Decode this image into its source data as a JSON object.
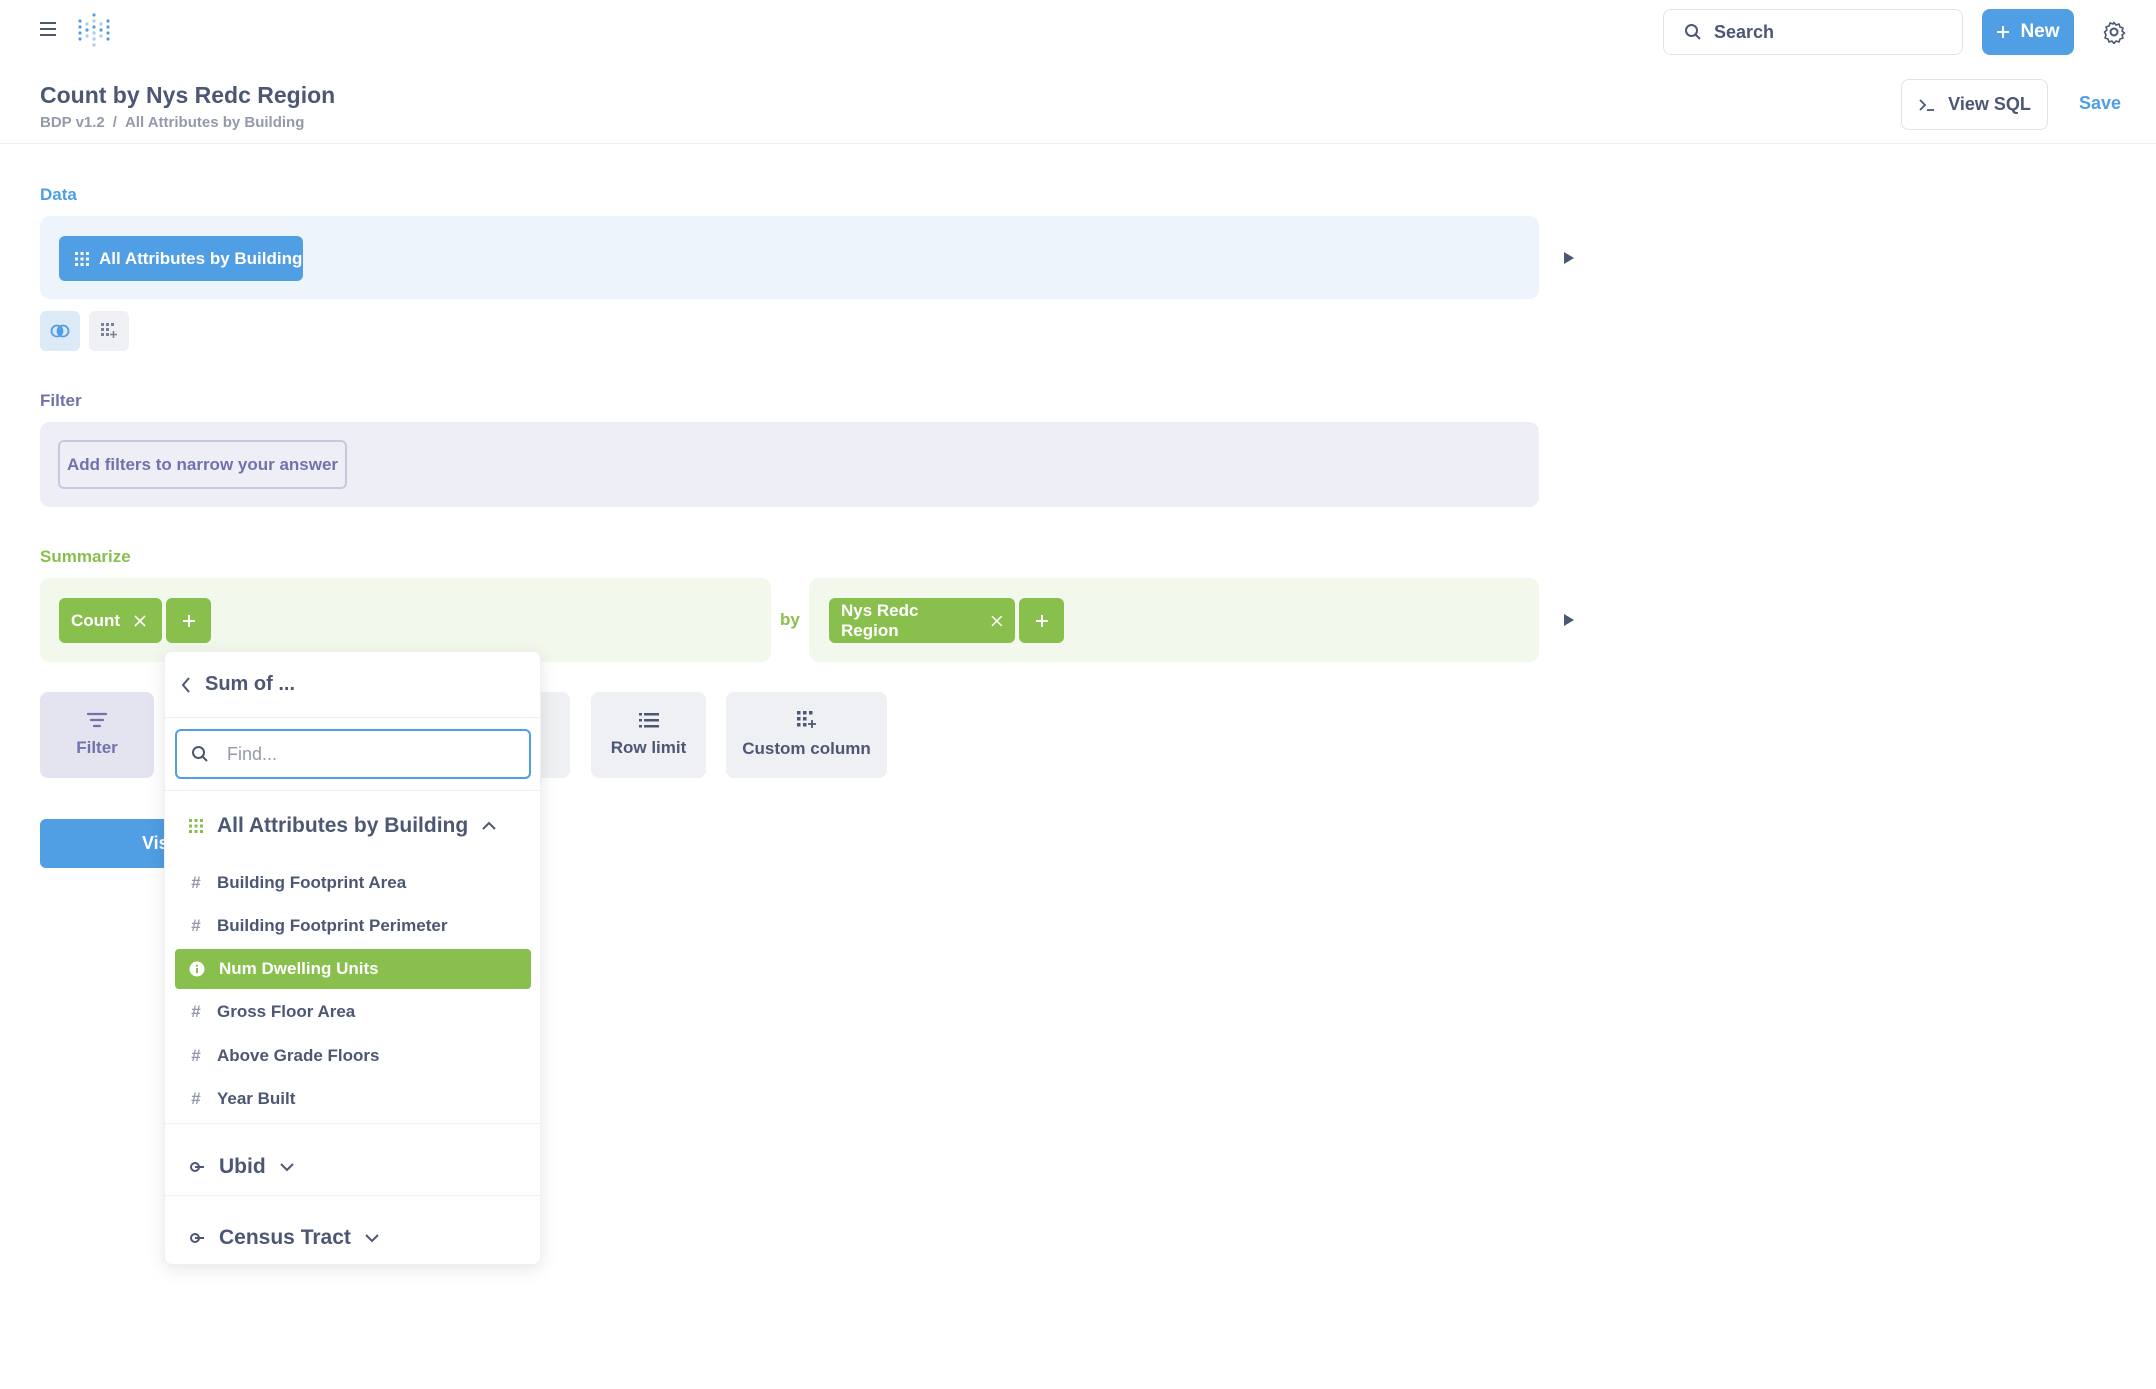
{
  "nav": {
    "search_label": "Search",
    "new_label": "New"
  },
  "header": {
    "title": "Count by Nys Redc Region",
    "breadcrumb": [
      "BDP v1.2",
      "/",
      "All Attributes by Building"
    ],
    "view_sql_label": "View SQL",
    "save_label": "Save"
  },
  "data_section": {
    "label": "Data",
    "table_name": "All Attributes by Building"
  },
  "filter_section": {
    "label": "Filter",
    "button_label": "Add filters to narrow your answer"
  },
  "summarize_section": {
    "label": "Summarize",
    "metric": "Count",
    "by_label": "by",
    "breakout": "Nys Redc Region"
  },
  "actions": {
    "filter": "Filter",
    "row_limit": "Row limit",
    "custom_column": "Custom column",
    "visualize_partial": "Vis"
  },
  "popover": {
    "header": "Sum of ...",
    "search_placeholder": "Find...",
    "groups": {
      "main": "All Attributes by Building",
      "ubid": "Ubid",
      "census": "Census Tract"
    },
    "items": [
      {
        "label": "Building Footprint Area"
      },
      {
        "label": "Building Footprint Perimeter"
      },
      {
        "label": "Num Dwelling Units"
      },
      {
        "label": "Gross Floor Area"
      },
      {
        "label": "Above Grade Floors"
      },
      {
        "label": "Year Built"
      }
    ],
    "selected_index": 2
  },
  "colors": {
    "brand": "#509ee3",
    "summarize": "#88bf4d",
    "filter": "#7172ad",
    "text": "#4c5773"
  }
}
